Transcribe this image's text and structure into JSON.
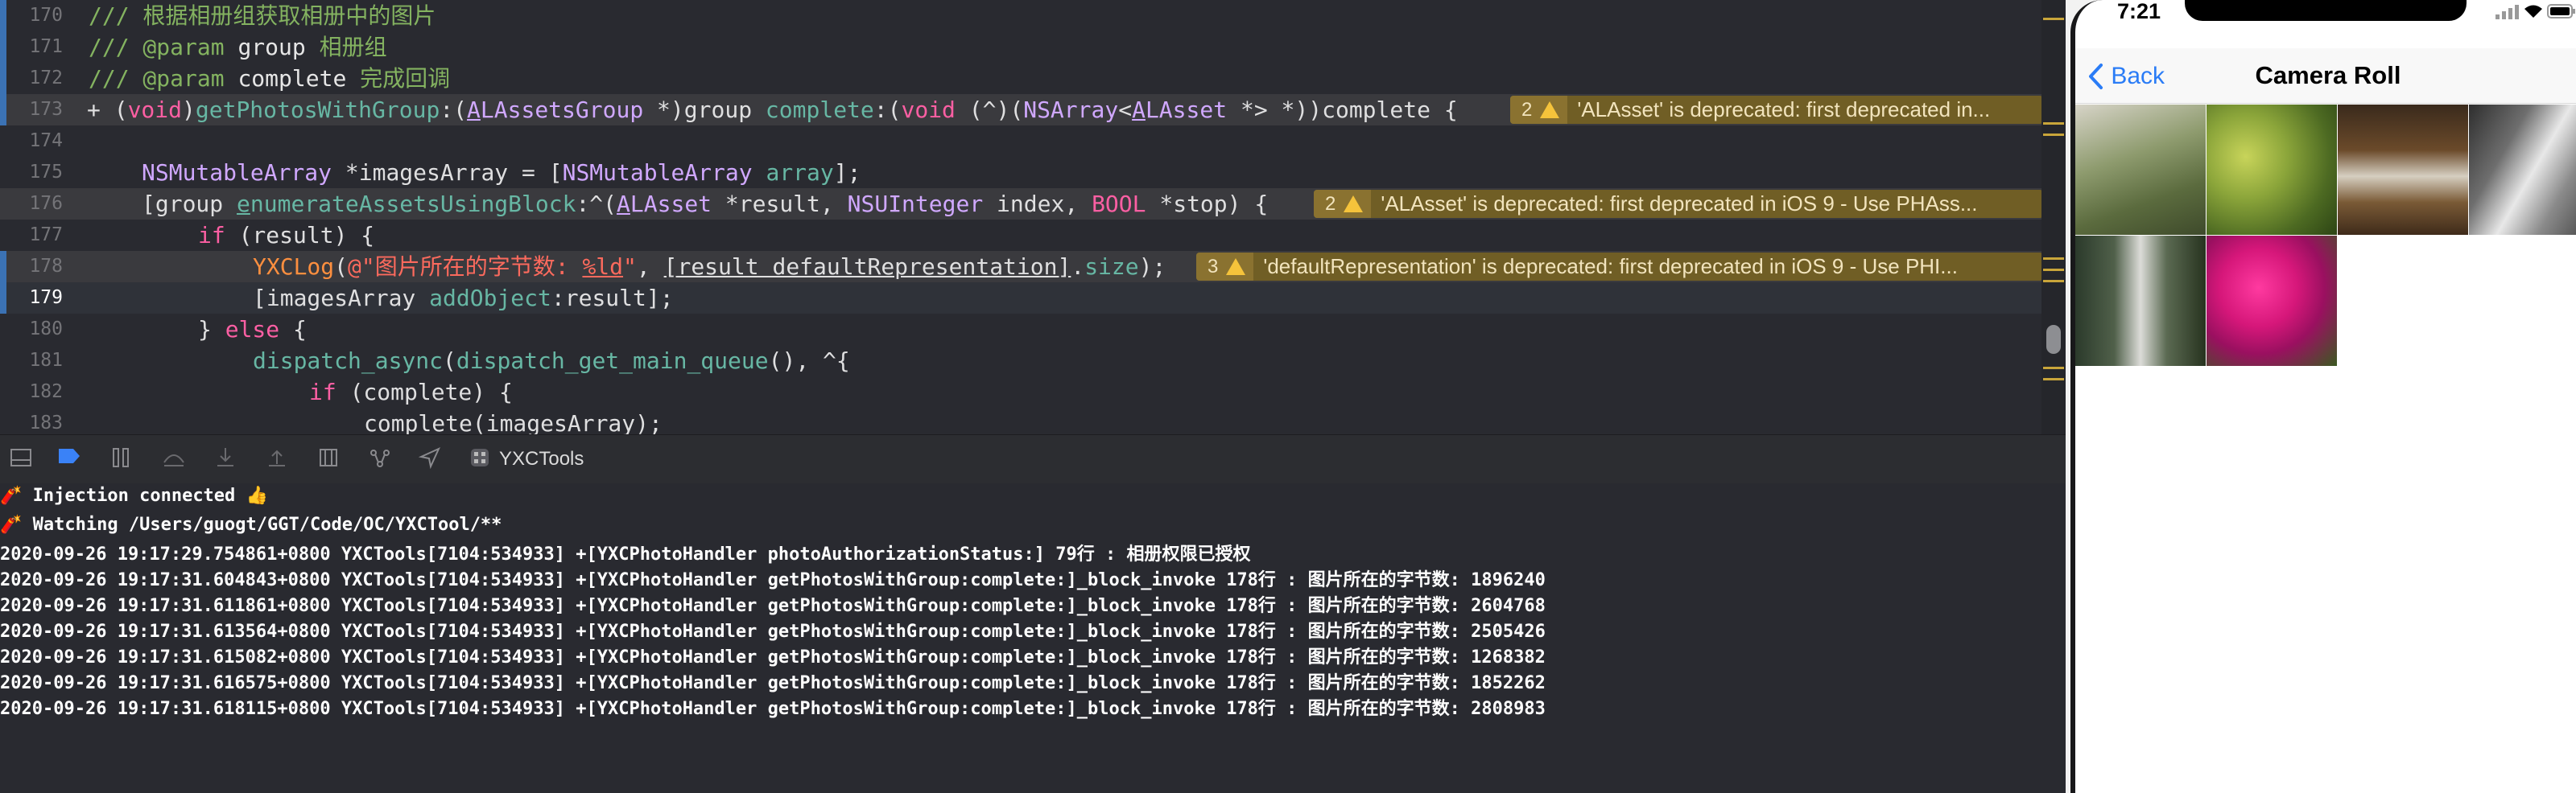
{
  "editor": {
    "lines": [
      {
        "num": "170",
        "text": "/// 根据相册组获取相册中的图片"
      },
      {
        "num": "171",
        "kw": "/// @param ",
        "name": "group",
        "desc": " 相册组"
      },
      {
        "num": "172",
        "kw": "/// @param ",
        "name": "complete",
        "desc": " 完成回调"
      },
      {
        "num": "173"
      },
      {
        "num": "174"
      },
      {
        "num": "175"
      },
      {
        "num": "176"
      },
      {
        "num": "177"
      },
      {
        "num": "178"
      },
      {
        "num": "179"
      },
      {
        "num": "180"
      },
      {
        "num": "181"
      },
      {
        "num": "182"
      },
      {
        "num": "183"
      }
    ],
    "warnings": [
      {
        "count": "2",
        "text": "'ALAsset' is deprecated: first deprecated in..."
      },
      {
        "count": "2",
        "text": "'ALAsset' is deprecated: first deprecated in iOS 9 - Use PHAss..."
      },
      {
        "count": "3",
        "text": "'defaultRepresentation' is deprecated: first deprecated in iOS 9 - Use PHI..."
      }
    ]
  },
  "toolbar": {
    "target_label": "YXCTools"
  },
  "console": {
    "lines": [
      "🧨 Injection connected 👍",
      "🧨 Watching /Users/guogt/GGT/Code/OC/YXCTool/**",
      "2020-09-26 19:17:29.754861+0800 YXCTools[7104:534933] +[YXCPhotoHandler photoAuthorizationStatus:] 79行 : 相册权限已授权",
      "2020-09-26 19:17:31.604843+0800 YXCTools[7104:534933] +[YXCPhotoHandler getPhotosWithGroup:complete:]_block_invoke 178行 : 图片所在的字节数: 1896240",
      "2020-09-26 19:17:31.611861+0800 YXCTools[7104:534933] +[YXCPhotoHandler getPhotosWithGroup:complete:]_block_invoke 178行 : 图片所在的字节数: 2604768",
      "2020-09-26 19:17:31.613564+0800 YXCTools[7104:534933] +[YXCPhotoHandler getPhotosWithGroup:complete:]_block_invoke 178行 : 图片所在的字节数: 2505426",
      "2020-09-26 19:17:31.615082+0800 YXCTools[7104:534933] +[YXCPhotoHandler getPhotosWithGroup:complete:]_block_invoke 178行 : 图片所在的字节数: 1268382",
      "2020-09-26 19:17:31.616575+0800 YXCTools[7104:534933] +[YXCPhotoHandler getPhotosWithGroup:complete:]_block_invoke 178行 : 图片所在的字节数: 1852262",
      "2020-09-26 19:17:31.618115+0800 YXCTools[7104:534933] +[YXCPhotoHandler getPhotosWithGroup:complete:]_block_invoke 178行 : 图片所在的字节数: 2808983"
    ]
  },
  "simulator": {
    "time": "7:21",
    "back_label": "Back",
    "title": "Camera Roll"
  },
  "colors": {
    "editor_bg": "#292a30",
    "comment": "#84b360",
    "keyword": "#fc5fa3",
    "type": "#5dd8ff",
    "warning_bg": "#705e25",
    "ios_blue": "#2a7cf6"
  }
}
